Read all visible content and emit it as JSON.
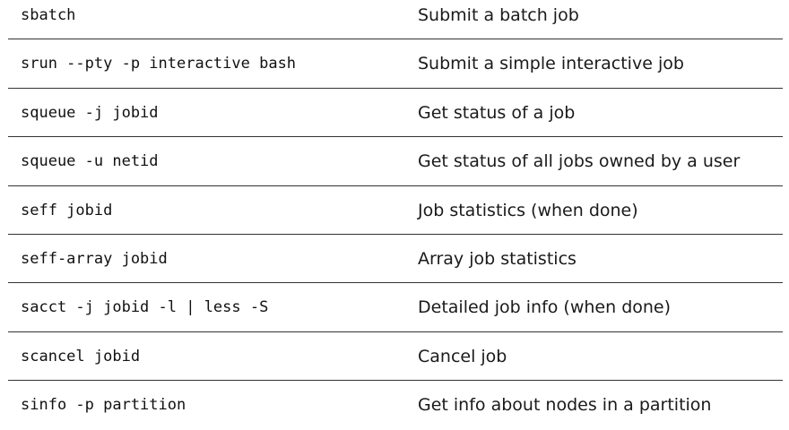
{
  "commands": [
    {
      "command": "sbatch",
      "description": "Submit a batch job"
    },
    {
      "command": "srun --pty -p interactive bash",
      "description": "Submit a simple interactive job"
    },
    {
      "command": "squeue -j jobid",
      "description": "Get status of a job"
    },
    {
      "command": "squeue -u netid",
      "description": "Get status of all jobs owned by a user"
    },
    {
      "command": "seff jobid",
      "description": "Job statistics (when done)"
    },
    {
      "command": "seff-array jobid",
      "description": "Array job statistics"
    },
    {
      "command": "sacct -j jobid -l | less -S",
      "description": "Detailed job info (when done)"
    },
    {
      "command": "scancel jobid",
      "description": "Cancel job"
    },
    {
      "command": "sinfo -p partition",
      "description": "Get info about nodes in a partition"
    }
  ]
}
